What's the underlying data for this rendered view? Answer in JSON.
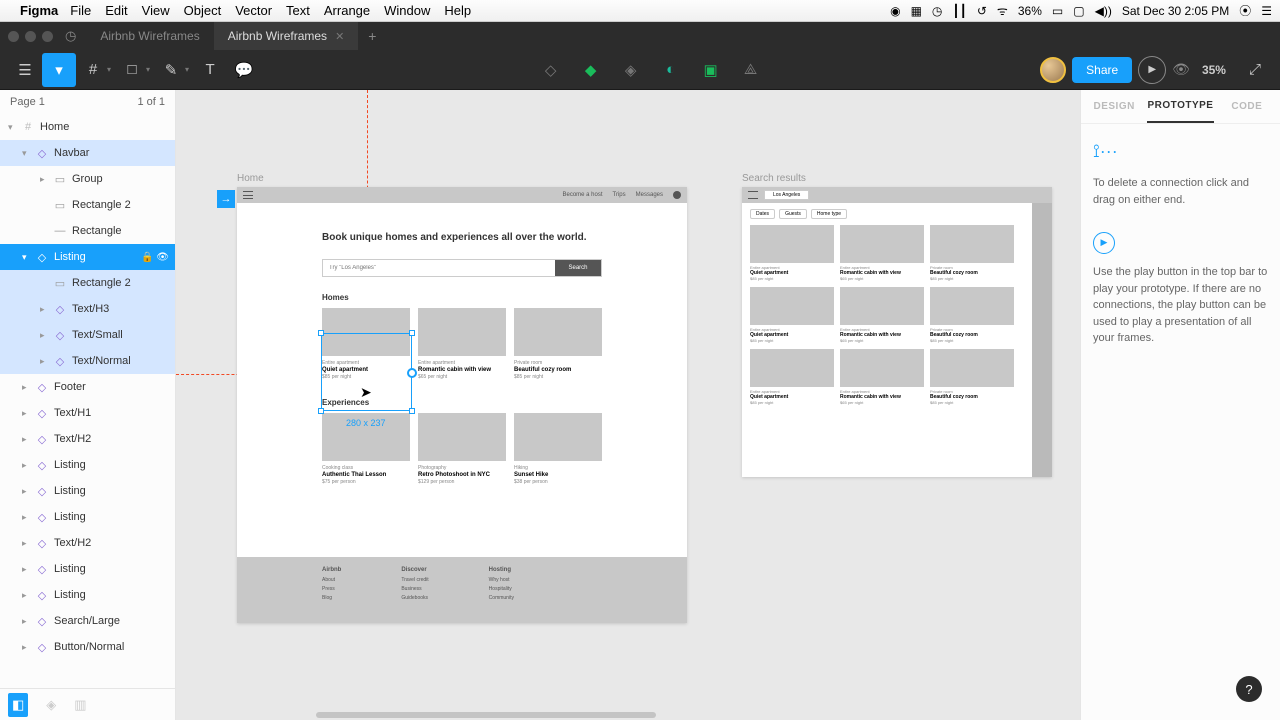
{
  "menubar": {
    "app": "Figma",
    "items": [
      "File",
      "Edit",
      "View",
      "Object",
      "Vector",
      "Text",
      "Arrange",
      "Window",
      "Help"
    ],
    "battery": "36%",
    "datetime": "Sat Dec 30  2:05 PM"
  },
  "tabs": {
    "inactive": "Airbnb Wireframes",
    "active": "Airbnb Wireframes"
  },
  "toolbar": {
    "share": "Share",
    "zoom": "35%"
  },
  "pages": {
    "label": "Page 1",
    "count": "1 of 1"
  },
  "layers": [
    {
      "lv": 0,
      "icon": "hash",
      "name": "Home",
      "chev": "▾"
    },
    {
      "lv": 1,
      "icon": "comp",
      "name": "Navbar",
      "chev": "▾",
      "sel": "light"
    },
    {
      "lv": 2,
      "icon": "rect",
      "name": "Group",
      "chev": "▸"
    },
    {
      "lv": 2,
      "icon": "rect",
      "name": "Rectangle 2"
    },
    {
      "lv": 2,
      "icon": "line",
      "name": "Rectangle"
    },
    {
      "lv": 1,
      "icon": "comp",
      "name": "Listing",
      "chev": "▾",
      "sel": "active",
      "actions": true
    },
    {
      "lv": 2,
      "icon": "rect",
      "name": "Rectangle 2",
      "sel": "light"
    },
    {
      "lv": 2,
      "icon": "comp",
      "name": "Text/H3",
      "chev": "▸",
      "sel": "light"
    },
    {
      "lv": 2,
      "icon": "comp",
      "name": "Text/Small",
      "chev": "▸",
      "sel": "light"
    },
    {
      "lv": 2,
      "icon": "comp",
      "name": "Text/Normal",
      "chev": "▸",
      "sel": "light"
    },
    {
      "lv": 1,
      "icon": "comp",
      "name": "Footer",
      "chev": "▸"
    },
    {
      "lv": 1,
      "icon": "comp",
      "name": "Text/H1",
      "chev": "▸"
    },
    {
      "lv": 1,
      "icon": "comp",
      "name": "Text/H2",
      "chev": "▸"
    },
    {
      "lv": 1,
      "icon": "comp",
      "name": "Listing",
      "chev": "▸"
    },
    {
      "lv": 1,
      "icon": "comp",
      "name": "Listing",
      "chev": "▸"
    },
    {
      "lv": 1,
      "icon": "comp",
      "name": "Listing",
      "chev": "▸"
    },
    {
      "lv": 1,
      "icon": "comp",
      "name": "Text/H2",
      "chev": "▸"
    },
    {
      "lv": 1,
      "icon": "comp",
      "name": "Listing",
      "chev": "▸"
    },
    {
      "lv": 1,
      "icon": "comp",
      "name": "Listing",
      "chev": "▸"
    },
    {
      "lv": 1,
      "icon": "comp",
      "name": "Search/Large",
      "chev": "▸"
    },
    {
      "lv": 1,
      "icon": "comp",
      "name": "Button/Normal",
      "chev": "▸"
    }
  ],
  "canvas": {
    "home_label": "Home",
    "search_label": "Search results",
    "sel_dim": "280 x 237",
    "home": {
      "nav": {
        "host": "Become a host",
        "trips": "Trips",
        "msgs": "Messages"
      },
      "hero": "Book unique homes and experiences all over the world.",
      "search_placeholder": "Try \"Los Angeles\"",
      "search_btn": "Search",
      "sec1": "Homes",
      "cards1": [
        {
          "cat": "Entire apartment",
          "title": "Quiet apartment",
          "price": "$85 per night"
        },
        {
          "cat": "Entire apartment",
          "title": "Romantic cabin with view",
          "price": "$65 per night"
        },
        {
          "cat": "Private room",
          "title": "Beautiful cozy room",
          "price": "$85 per night"
        }
      ],
      "sec2": "Experiences",
      "cards2": [
        {
          "cat": "Cooking class",
          "title": "Authentic Thai Lesson",
          "price": "$75 per person"
        },
        {
          "cat": "Photography",
          "title": "Retro Photoshoot in NYC",
          "price": "$129 per person"
        },
        {
          "cat": "Hiking",
          "title": "Sunset Hike",
          "price": "$38 per person"
        }
      ],
      "footer": [
        {
          "h": "Airbnb",
          "items": [
            "About",
            "Press",
            "Blog"
          ]
        },
        {
          "h": "Discover",
          "items": [
            "Travel credit",
            "Business",
            "Guidebooks"
          ]
        },
        {
          "h": "Hosting",
          "items": [
            "Why host",
            "Hospitality",
            "Community"
          ]
        }
      ]
    },
    "search": {
      "loc": "Los Angeles",
      "filters": [
        "Dates",
        "Guests",
        "Home type"
      ],
      "cards": [
        {
          "cat": "Entire apartment",
          "title": "Quiet apartment",
          "price": "$85 per night"
        },
        {
          "cat": "Entire apartment",
          "title": "Romantic cabin with view",
          "price": "$65 per night"
        },
        {
          "cat": "Private room",
          "title": "Beautiful cozy room",
          "price": "$85 per night"
        },
        {
          "cat": "Entire apartment",
          "title": "Quiet apartment",
          "price": "$85 per night"
        },
        {
          "cat": "Entire apartment",
          "title": "Romantic cabin with view",
          "price": "$65 per night"
        },
        {
          "cat": "Private room",
          "title": "Beautiful cozy room",
          "price": "$85 per night"
        },
        {
          "cat": "Entire apartment",
          "title": "Quiet apartment",
          "price": "$85 per night"
        },
        {
          "cat": "Entire apartment",
          "title": "Romantic cabin with view",
          "price": "$65 per night"
        },
        {
          "cat": "Private room",
          "title": "Beautiful cozy room",
          "price": "$85 per night"
        }
      ]
    }
  },
  "rpanel": {
    "tabs": [
      "DESIGN",
      "PROTOTYPE",
      "CODE"
    ],
    "tip1": "To delete a connection click and drag on either end.",
    "tip2": "Use the play button in the top bar to play your prototype. If there are no connections, the play button can be used to play a presentation of all your frames."
  }
}
